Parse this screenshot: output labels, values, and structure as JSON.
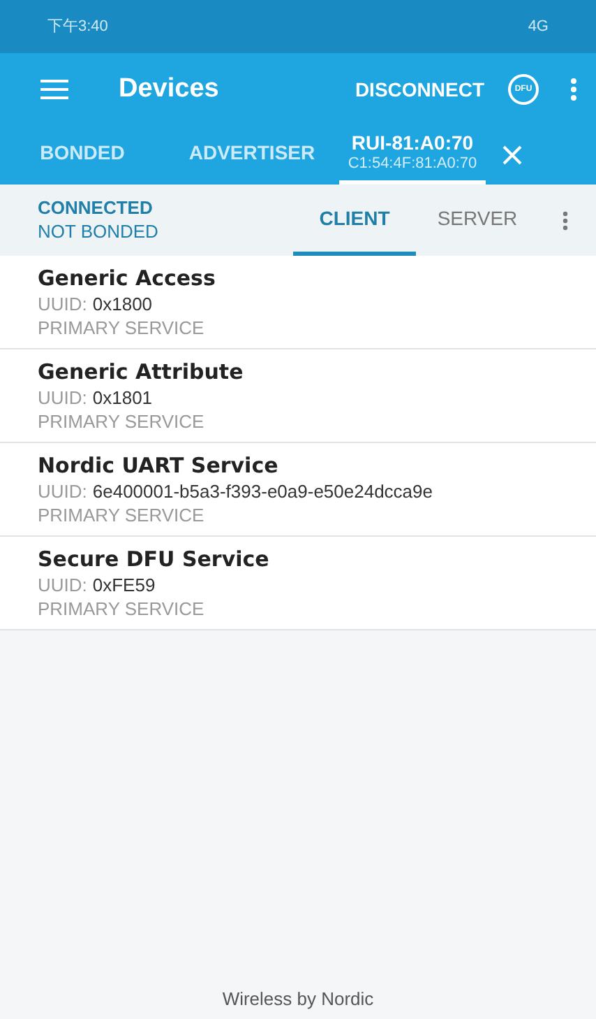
{
  "status_bar": {
    "time": "下午3:40",
    "network": "4G"
  },
  "toolbar": {
    "title": "Devices",
    "action": "DISCONNECT",
    "dfu_label": "DFU"
  },
  "tabs": [
    {
      "label": "BONDED",
      "selected": false
    },
    {
      "label": "ADVERTISER",
      "selected": false
    },
    {
      "label": "RUI-81:A0:70",
      "address": "C1:54:4F:81:A0:70",
      "selected": true
    }
  ],
  "connection": {
    "state": "CONNECTED",
    "bond": "NOT BONDED"
  },
  "subtabs": [
    {
      "label": "CLIENT",
      "selected": true
    },
    {
      "label": "SERVER",
      "selected": false
    }
  ],
  "services": [
    {
      "name": "Generic Access",
      "uuid_label": "UUID:",
      "uuid": "0x1800",
      "type": "PRIMARY SERVICE"
    },
    {
      "name": "Generic Attribute",
      "uuid_label": "UUID:",
      "uuid": "0x1801",
      "type": "PRIMARY SERVICE"
    },
    {
      "name": "Nordic UART Service",
      "uuid_label": "UUID:",
      "uuid": "6e400001-b5a3-f393-e0a9-e50e24dcca9e",
      "type": "PRIMARY SERVICE"
    },
    {
      "name": "Secure DFU Service",
      "uuid_label": "UUID:",
      "uuid": "0xFE59",
      "type": "PRIMARY SERVICE"
    }
  ],
  "footer": "Wireless by Nordic"
}
